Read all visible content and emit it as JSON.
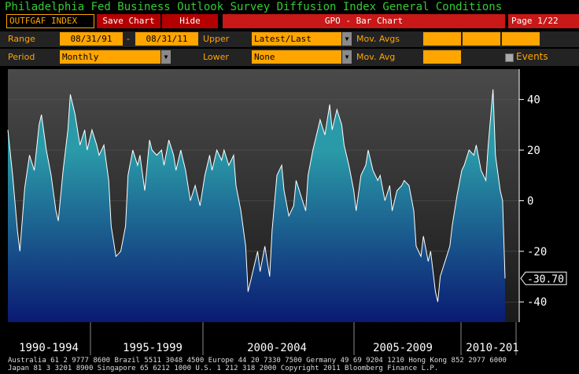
{
  "title": "Philadelphia Fed Business Outlook Survey Diffusion Index General Conditions",
  "toolbar": {
    "ticker": "OUTFGAF INDEX",
    "save_chart": "Save Chart",
    "hide": "Hide",
    "chart_type": "GPO - Bar Chart",
    "page": "Page 1/22"
  },
  "controls": {
    "range_label": "Range",
    "range_start": "08/31/91",
    "range_dash": "-",
    "range_end": "08/31/11",
    "upper_label": "Upper",
    "upper_value": "Latest/Last Revis",
    "mov_avgs_label": "Mov. Avgs",
    "period_label": "Period",
    "period_value": "Monthly",
    "lower_label": "Lower",
    "lower_value": "None",
    "mov_avg_label": "Mov. Avg",
    "events_label": "Events"
  },
  "chart_data": {
    "type": "area",
    "y_ticks": [
      "40",
      "20",
      "0",
      "-20",
      "-40"
    ],
    "y_tick_values": [
      40,
      20,
      0,
      -20,
      -40
    ],
    "ylim": [
      -48,
      52
    ],
    "last_value_label": "-30.70",
    "last_value": -30.7,
    "x_labels": [
      "1990-1994",
      "1995-1999",
      "2000-2004",
      "2005-2009",
      "2010-201"
    ],
    "x_range": [
      1991.0,
      2011.7
    ],
    "series": [
      {
        "points": [
          [
            1991.0,
            28
          ],
          [
            1991.2,
            10
          ],
          [
            1991.4,
            -12
          ],
          [
            1991.5,
            -20
          ],
          [
            1991.7,
            5
          ],
          [
            1991.9,
            18
          ],
          [
            1992.1,
            12
          ],
          [
            1992.3,
            30
          ],
          [
            1992.4,
            34
          ],
          [
            1992.6,
            20
          ],
          [
            1992.8,
            10
          ],
          [
            1993.0,
            -4
          ],
          [
            1993.1,
            -8
          ],
          [
            1993.3,
            12
          ],
          [
            1993.5,
            28
          ],
          [
            1993.6,
            42
          ],
          [
            1993.8,
            34
          ],
          [
            1994.0,
            22
          ],
          [
            1994.2,
            28
          ],
          [
            1994.3,
            20
          ],
          [
            1994.5,
            28
          ],
          [
            1994.7,
            22
          ],
          [
            1994.8,
            18
          ],
          [
            1995.0,
            22
          ],
          [
            1995.2,
            8
          ],
          [
            1995.3,
            -10
          ],
          [
            1995.5,
            -22
          ],
          [
            1995.7,
            -20
          ],
          [
            1995.9,
            -10
          ],
          [
            1996.0,
            10
          ],
          [
            1996.2,
            20
          ],
          [
            1996.4,
            14
          ],
          [
            1996.5,
            18
          ],
          [
            1996.7,
            4
          ],
          [
            1996.9,
            24
          ],
          [
            1997.0,
            20
          ],
          [
            1997.2,
            18
          ],
          [
            1997.4,
            20
          ],
          [
            1997.5,
            14
          ],
          [
            1997.7,
            24
          ],
          [
            1997.9,
            18
          ],
          [
            1998.0,
            12
          ],
          [
            1998.2,
            20
          ],
          [
            1998.4,
            12
          ],
          [
            1998.6,
            0
          ],
          [
            1998.8,
            6
          ],
          [
            1999.0,
            -2
          ],
          [
            1999.2,
            10
          ],
          [
            1999.4,
            18
          ],
          [
            1999.5,
            12
          ],
          [
            1999.7,
            20
          ],
          [
            1999.9,
            16
          ],
          [
            2000.0,
            20
          ],
          [
            2000.2,
            14
          ],
          [
            2000.4,
            18
          ],
          [
            2000.5,
            6
          ],
          [
            2000.7,
            -4
          ],
          [
            2000.9,
            -18
          ],
          [
            2001.0,
            -36
          ],
          [
            2001.2,
            -28
          ],
          [
            2001.4,
            -20
          ],
          [
            2001.5,
            -28
          ],
          [
            2001.7,
            -18
          ],
          [
            2001.9,
            -30
          ],
          [
            2002.0,
            -12
          ],
          [
            2002.2,
            10
          ],
          [
            2002.4,
            14
          ],
          [
            2002.5,
            4
          ],
          [
            2002.7,
            -6
          ],
          [
            2002.9,
            -2
          ],
          [
            2003.0,
            8
          ],
          [
            2003.2,
            2
          ],
          [
            2003.4,
            -4
          ],
          [
            2003.5,
            10
          ],
          [
            2003.7,
            20
          ],
          [
            2003.9,
            28
          ],
          [
            2004.0,
            32
          ],
          [
            2004.2,
            26
          ],
          [
            2004.4,
            38
          ],
          [
            2004.5,
            28
          ],
          [
            2004.7,
            36
          ],
          [
            2004.9,
            30
          ],
          [
            2005.0,
            22
          ],
          [
            2005.2,
            14
          ],
          [
            2005.4,
            4
          ],
          [
            2005.5,
            -4
          ],
          [
            2005.7,
            10
          ],
          [
            2005.9,
            14
          ],
          [
            2006.0,
            20
          ],
          [
            2006.2,
            12
          ],
          [
            2006.4,
            8
          ],
          [
            2006.5,
            10
          ],
          [
            2006.7,
            0
          ],
          [
            2006.9,
            6
          ],
          [
            2007.0,
            -4
          ],
          [
            2007.2,
            4
          ],
          [
            2007.4,
            6
          ],
          [
            2007.5,
            8
          ],
          [
            2007.7,
            6
          ],
          [
            2007.9,
            -4
          ],
          [
            2008.0,
            -18
          ],
          [
            2008.2,
            -22
          ],
          [
            2008.3,
            -14
          ],
          [
            2008.5,
            -24
          ],
          [
            2008.6,
            -20
          ],
          [
            2008.8,
            -36
          ],
          [
            2008.9,
            -40
          ],
          [
            2009.0,
            -30
          ],
          [
            2009.2,
            -24
          ],
          [
            2009.4,
            -18
          ],
          [
            2009.5,
            -10
          ],
          [
            2009.7,
            2
          ],
          [
            2009.9,
            12
          ],
          [
            2010.0,
            14
          ],
          [
            2010.2,
            20
          ],
          [
            2010.4,
            18
          ],
          [
            2010.5,
            22
          ],
          [
            2010.7,
            12
          ],
          [
            2010.9,
            8
          ],
          [
            2011.0,
            22
          ],
          [
            2011.2,
            44
          ],
          [
            2011.3,
            18
          ],
          [
            2011.5,
            4
          ],
          [
            2011.6,
            0
          ],
          [
            2011.7,
            -30.7
          ]
        ]
      }
    ],
    "colors": {
      "gradient_top": "#2a9aa8",
      "gradient_bottom": "#0a1a72",
      "line": "#ffffff"
    }
  },
  "footer": {
    "line1": "Australia 61 2 9777 8600 Brazil 5511 3048 4500 Europe 44 20 7330 7500 Germany 49 69 9204 1210 Hong Kong 852 2977 6000",
    "line2": "Japan 81 3 3201 8900          Singapore 65 6212 1000          U.S. 1 212 318 2000          Copyright 2011 Bloomberg Finance L.P."
  }
}
